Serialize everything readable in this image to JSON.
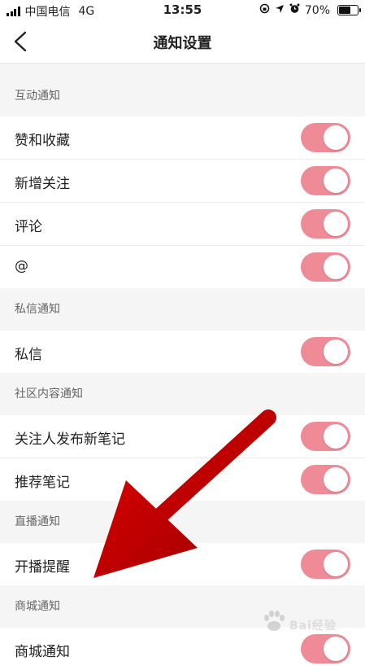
{
  "status_bar": {
    "carrier": "中国电信",
    "network": "4G",
    "time": "13:55",
    "battery_text": "70%",
    "battery_level": 0.7
  },
  "nav": {
    "title": "通知设置"
  },
  "sections": [
    {
      "header": "互动通知",
      "items": [
        {
          "label": "赞和收藏",
          "on": true
        },
        {
          "label": "新增关注",
          "on": true
        },
        {
          "label": "评论",
          "on": true
        },
        {
          "label": "@",
          "on": true
        }
      ]
    },
    {
      "header": "私信通知",
      "items": [
        {
          "label": "私信",
          "on": true
        }
      ]
    },
    {
      "header": "社区内容通知",
      "items": [
        {
          "label": "关注人发布新笔记",
          "on": true
        },
        {
          "label": "推荐笔记",
          "on": true
        }
      ]
    },
    {
      "header": "直播通知",
      "items": [
        {
          "label": "开播提醒",
          "on": true
        }
      ]
    },
    {
      "header": "商城通知",
      "items": [
        {
          "label": "商城通知",
          "on": true
        }
      ]
    }
  ],
  "colors": {
    "toggle_on": "#ef8b97",
    "annotation_arrow": "#c00000",
    "background": "#f5f5f5"
  },
  "watermark": {
    "text": "Bai经验"
  }
}
